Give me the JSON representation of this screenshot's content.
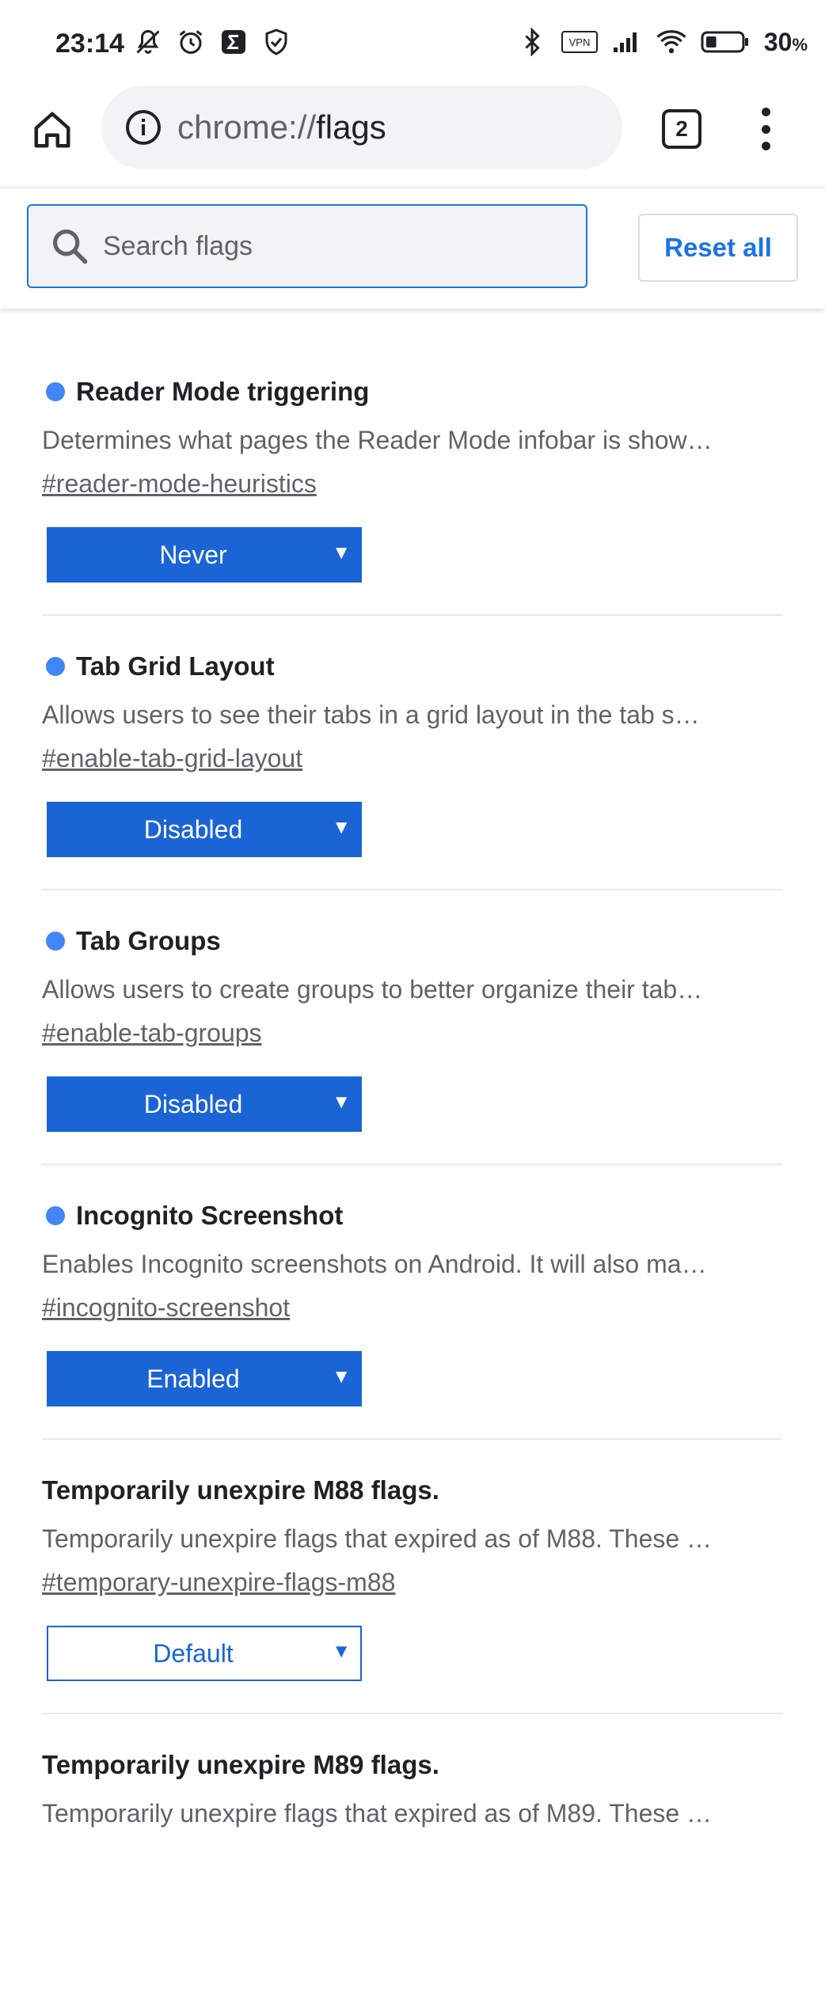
{
  "status_bar": {
    "time": "23:14",
    "left_icons": [
      "mute-notifications-icon",
      "alarm-icon",
      "sigma-app-icon",
      "shield-check-icon"
    ],
    "right_icons": [
      "bluetooth-icon",
      "vpn-icon",
      "cell-signal-icon",
      "wifi-icon",
      "battery-icon"
    ],
    "vpn_label": "VPN",
    "battery_percent": "30",
    "battery_unit": "%",
    "battery_level": 0.3
  },
  "toolbar": {
    "url_scheme": "chrome://",
    "url_path": "flags",
    "tab_count": "2"
  },
  "header": {
    "search_placeholder": "Search flags",
    "reset_label": "Reset all"
  },
  "colors": {
    "accent": "#1a73e8",
    "select_fill": "#1a64d6",
    "dot": "#4285f4"
  },
  "experiments": [
    {
      "title": "Reader Mode triggering",
      "description": "Determines what pages the Reader Mode infobar is show…",
      "link": "#reader-mode-heuristics",
      "value": "Never",
      "modified": true
    },
    {
      "title": "Tab Grid Layout",
      "description": "Allows users to see their tabs in a grid layout in the tab s…",
      "link": "#enable-tab-grid-layout",
      "value": "Disabled",
      "modified": true
    },
    {
      "title": "Tab Groups",
      "description": "Allows users to create groups to better organize their tab…",
      "link": "#enable-tab-groups",
      "value": "Disabled",
      "modified": true
    },
    {
      "title": "Incognito Screenshot",
      "description": "Enables Incognito screenshots on Android. It will also ma…",
      "link": "#incognito-screenshot",
      "value": "Enabled",
      "modified": true
    },
    {
      "title": "Temporarily unexpire M88 flags.",
      "description": "Temporarily unexpire flags that expired as of M88. These …",
      "link": "#temporary-unexpire-flags-m88",
      "value": "Default",
      "modified": false
    },
    {
      "title": "Temporarily unexpire M89 flags.",
      "description": "Temporarily unexpire flags that expired as of M89. These …",
      "link": "",
      "value": "",
      "modified": false
    }
  ]
}
